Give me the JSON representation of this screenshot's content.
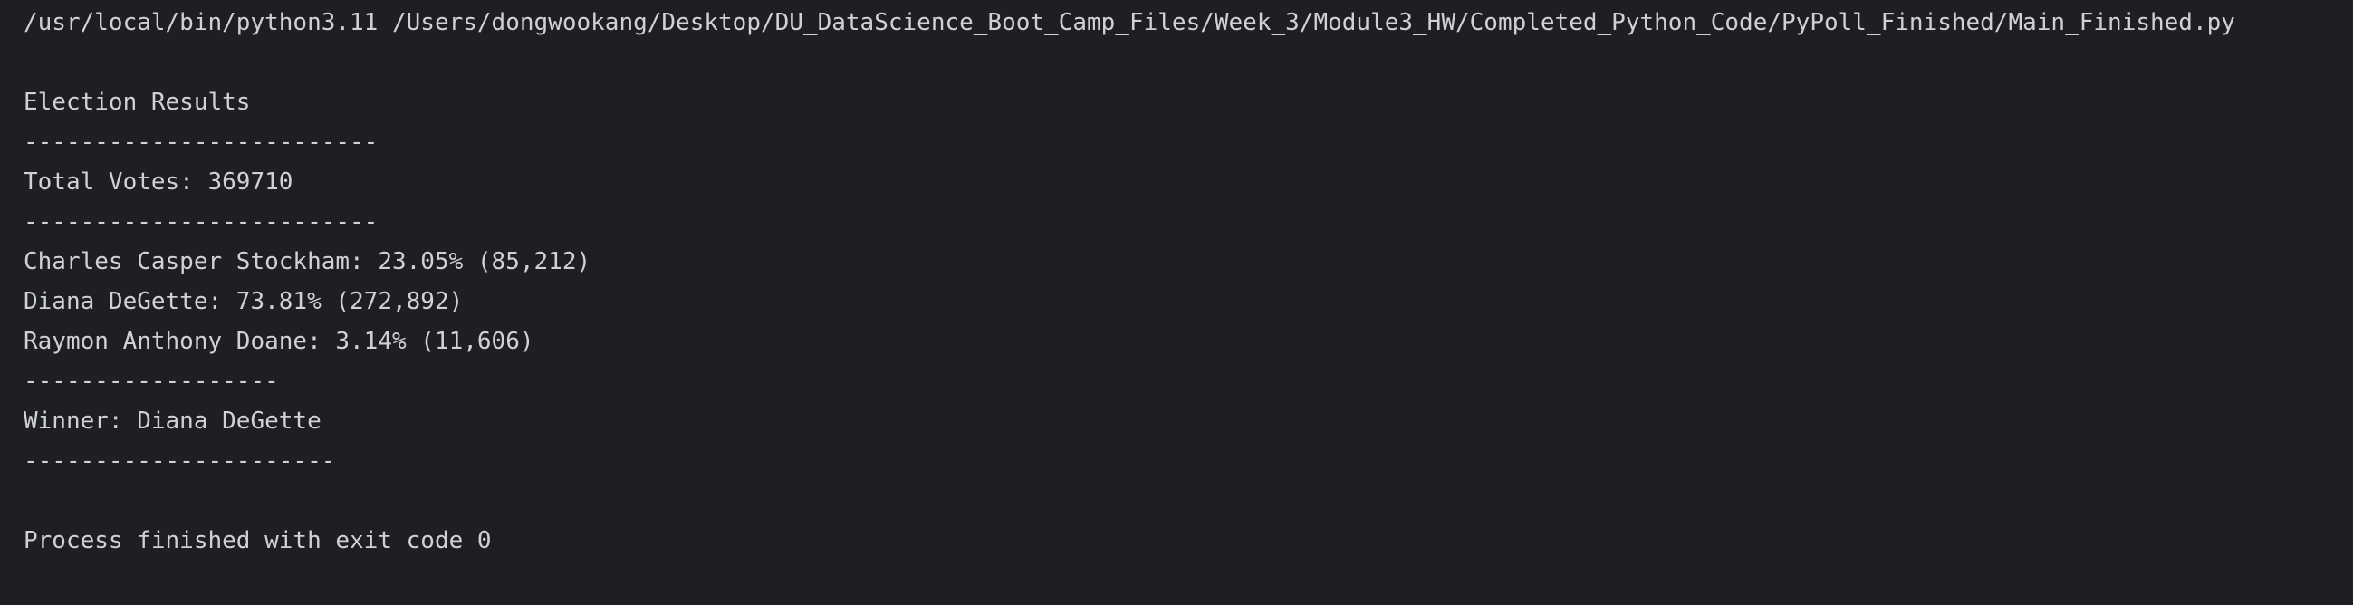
{
  "console": {
    "command": "/usr/local/bin/python3.11 /Users/dongwookang/Desktop/DU_DataScience_Boot_Camp_Files/Week_3/Module3_HW/Completed_Python_Code/PyPoll_Finished/Main_Finished.py",
    "title": "Election Results",
    "separator_1": "-------------------------",
    "total_votes": "Total Votes: 369710",
    "separator_2": "-------------------------",
    "candidates": [
      "Charles Casper Stockham: 23.05% (85,212)",
      "Diana DeGette: 73.81% (272,892)",
      "Raymon Anthony Doane: 3.14% (11,606)"
    ],
    "separator_3": "------------------",
    "winner": "Winner: Diana DeGette",
    "separator_4": "----------------------",
    "exit_message": "Process finished with exit code 0"
  },
  "colors": {
    "background": "#1e1f22",
    "text": "#cfd1d6"
  }
}
